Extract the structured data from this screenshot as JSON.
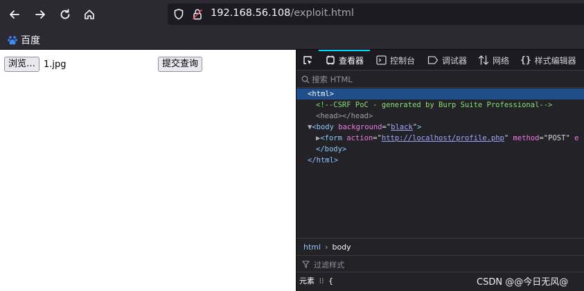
{
  "browser": {
    "url_host": "192.168.56.108",
    "url_path": "/exploit.html",
    "bookmark_label": "百度"
  },
  "page": {
    "browse_button": "浏览…",
    "file_name": "1.jpg",
    "submit_button": "提交查询"
  },
  "devtools": {
    "tabs": [
      {
        "label": "查看器",
        "icon": "inspector-icon",
        "active": true
      },
      {
        "label": "控制台",
        "icon": "console-icon",
        "active": false
      },
      {
        "label": "调试器",
        "icon": "debugger-icon",
        "active": false
      },
      {
        "label": "网络",
        "icon": "network-icon",
        "active": false
      },
      {
        "label": "样式编辑器",
        "icon": "style-editor-icon",
        "active": false
      }
    ],
    "search_placeholder": "搜索 HTML",
    "tree": {
      "html_open": "<html>",
      "comment": "<!--CSRF PoC - generated by Burp Suite Professional-->",
      "head": "<head></head>",
      "body_tag": "body",
      "body_attr": "background",
      "body_val": "black",
      "form_tag": "form",
      "form_action_attr": "action",
      "form_action_val": "http://localhost/profile.php",
      "form_method_attr": "method",
      "form_method_val": "POST",
      "form_tail": "e",
      "body_close": "</body>",
      "html_close": "</html>"
    },
    "breadcrumb": [
      "html",
      "body"
    ],
    "filter_placeholder": "过滤样式",
    "rule_label": "元素",
    "rule_brace": "{"
  },
  "watermark": "CSDN @@今日无风@",
  "colors": {
    "selection": "#204e8a",
    "tab_accent": "#00ddff"
  }
}
